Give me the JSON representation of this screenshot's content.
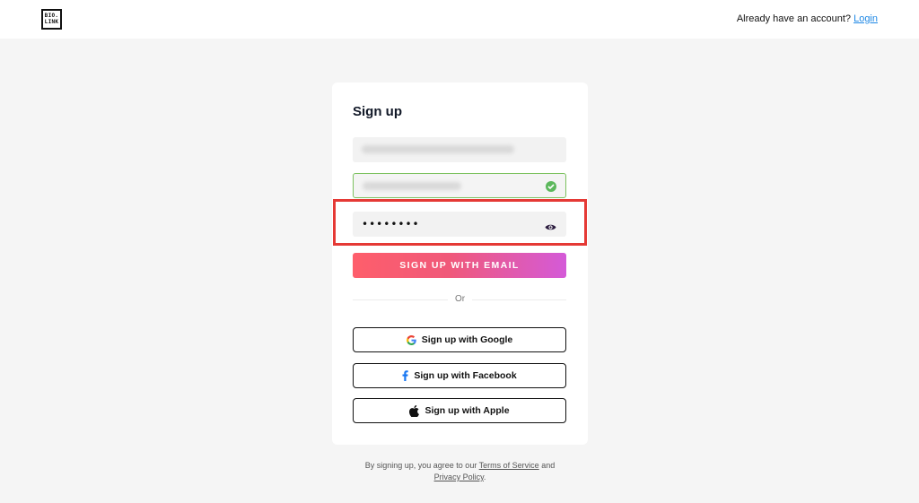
{
  "header": {
    "logo_line1": "BIO.",
    "logo_line2": "LINK",
    "account_text": "Already have an account?",
    "login_link": "Login"
  },
  "form": {
    "title": "Sign up",
    "password_value": "••••••••",
    "submit_label": "SIGN UP WITH EMAIL",
    "divider_label": "Or",
    "google_label": "Sign up with Google",
    "facebook_label": "Sign up with Facebook",
    "apple_label": "Sign up with Apple"
  },
  "footer": {
    "prefix": "By signing up, you agree to our",
    "terms_link": "Terms of Service",
    "and": "and",
    "privacy_link": "Privacy Policy",
    "suffix": "."
  },
  "icons": {
    "check": "check-circle-icon",
    "eye": "eye-icon",
    "google": "google-icon",
    "facebook": "facebook-icon",
    "apple": "apple-icon"
  },
  "colors": {
    "valid_border": "#7cc25f",
    "gradient_start": "#fe5e6b",
    "gradient_end": "#d45ad8",
    "highlight": "#e53935",
    "link": "#1e88e5"
  }
}
